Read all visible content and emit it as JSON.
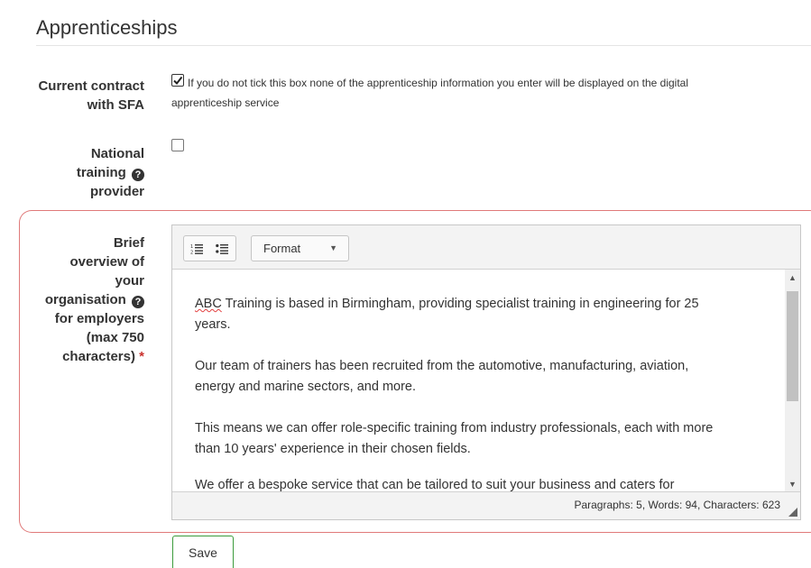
{
  "section": {
    "title": "Apprenticeships"
  },
  "contract": {
    "label_line1": "Current contract",
    "label_line2": "with SFA",
    "checked": true,
    "hint_line1": "If you do not tick this box none of the apprenticeship information you enter will be displayed on the digital",
    "hint_line2": "apprenticeship service"
  },
  "national": {
    "label_line1": "National",
    "label_line2": "training",
    "label_line3": "provider",
    "checked": false,
    "help_icon": "question-circle-icon"
  },
  "overview": {
    "label_lines": [
      "Brief",
      "overview of",
      "your",
      "organisation",
      "for employers",
      "(max 750",
      "characters)"
    ],
    "required_mark": "*",
    "help_icon": "question-circle-icon"
  },
  "editor": {
    "toolbar": {
      "ordered_list_icon": "ordered-list-icon",
      "bullet_list_icon": "bullet-list-icon",
      "format_label": "Format"
    },
    "paragraphs": [
      {
        "first_word": "ABC",
        "rest_line1": " Training is based in Birmingham, providing specialist training in engineering for 25",
        "line2": "years."
      },
      {
        "line1": "Our team of trainers has been recruited from the automotive, manufacturing, aviation,",
        "line2": "energy and marine sectors, and more."
      },
      {
        "line1": "This means we can offer role-specific training from industry professionals, each with more",
        "line2": "than 10 years' experience in their chosen fields."
      },
      {
        "line1": "We offer a bespoke service that can be tailored to suit your business and caters for"
      }
    ],
    "status": "Paragraphs: 5, Words: 94, Characters: 623"
  },
  "save_label": "Save",
  "colors": {
    "error_border": "#e07a7a",
    "save_border": "#3c9b3c",
    "required": "#c9302c"
  }
}
